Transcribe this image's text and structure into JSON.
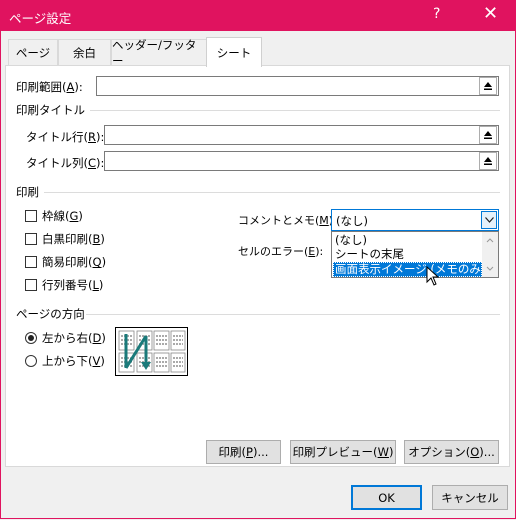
{
  "window": {
    "title": "ページ設定",
    "help": "?",
    "close": "✕"
  },
  "tabs": [
    {
      "label": "ページ"
    },
    {
      "label": "余白"
    },
    {
      "label": "ヘッダー/フッター"
    },
    {
      "label": "シート"
    }
  ],
  "print_area": {
    "label": "印刷範囲(",
    "key": "A",
    "suffix": "):",
    "value": ""
  },
  "print_titles": {
    "section": "印刷タイトル",
    "rows_label": "タイトル行(",
    "rows_key": "R",
    "rows_suffix": "):",
    "cols_label": "タイトル列(",
    "cols_key": "C",
    "cols_suffix": "):"
  },
  "print": {
    "section": "印刷",
    "gridlines": {
      "label": "枠線(",
      "key": "G",
      "suffix": ")",
      "checked": false
    },
    "black_white": {
      "label": "白黒印刷(",
      "key": "B",
      "suffix": ")",
      "checked": false
    },
    "draft": {
      "label": "簡易印刷(",
      "key": "Q",
      "suffix": ")",
      "checked": false
    },
    "headings": {
      "label": "行列番号(",
      "key": "L",
      "suffix": ")",
      "checked": false
    },
    "comments": {
      "label": "コメントとメモ(",
      "key": "M",
      "suffix": "):",
      "value": "(なし)",
      "options": [
        "(なし)",
        "シートの末尾",
        "画面表示イメージ (メモのみ)"
      ],
      "highlighted": 2
    },
    "errors": {
      "label": "セルのエラー(",
      "key": "E",
      "suffix": "):"
    }
  },
  "page_order": {
    "section": "ページの方向",
    "down_then_over": {
      "label": "左から右(",
      "key": "D",
      "suffix": ")",
      "selected": true
    },
    "over_then_down": {
      "label": "上から下(",
      "key": "V",
      "suffix": ")",
      "selected": false
    }
  },
  "buttons": {
    "print": {
      "label": "印刷(",
      "key": "P",
      "suffix": ")..."
    },
    "preview": {
      "label": "印刷プレビュー(",
      "key": "W",
      "suffix": ")"
    },
    "options": {
      "label": "オプション(",
      "key": "O",
      "suffix": ")..."
    },
    "ok": "OK",
    "cancel": "キャンセル"
  },
  "colors": {
    "titlebar": "#e0135f",
    "accent": "#0078d7",
    "arrow": "#1a7a7a"
  }
}
